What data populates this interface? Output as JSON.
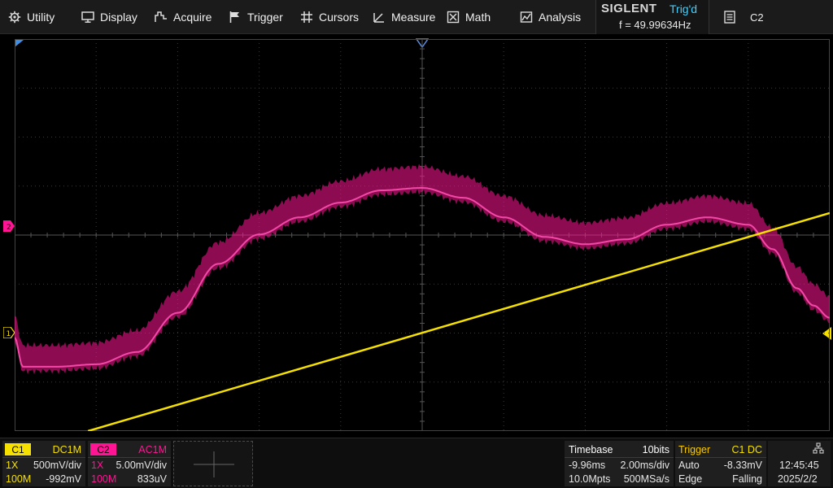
{
  "menu": {
    "utility": "Utility",
    "display": "Display",
    "acquire": "Acquire",
    "trigger": "Trigger",
    "cursors": "Cursors",
    "measure": "Measure",
    "math": "Math",
    "analysis": "Analysis"
  },
  "brand": "SIGLENT",
  "trigger_state": "Trig'd",
  "frequency": "f = 49.99634Hz",
  "channel_button": "C2",
  "colors": {
    "c1": "#f5e000",
    "c2": "#ff1493",
    "trig_label": "#f5c800",
    "panel_bg": "#1f1f1f",
    "grid": "#3a3a3a"
  },
  "c1": {
    "tag": "C1",
    "coupling": "DC1M",
    "probe": "1X",
    "scale": "500mV/div",
    "bandwidth": "100M",
    "offset": "-992mV"
  },
  "c2": {
    "tag": "C2",
    "coupling": "AC1M",
    "probe": "1X",
    "scale": "5.00mV/div",
    "bandwidth": "100M",
    "offset": "833uV"
  },
  "timebase": {
    "label": "Timebase",
    "bits": "10bits",
    "delay": "-9.96ms",
    "scale": "2.00ms/div",
    "memory": "10.0Mpts",
    "sample_rate": "500MSa/s"
  },
  "trigger_panel": {
    "label": "Trigger",
    "source": "C1 DC",
    "mode": "Auto",
    "level": "-8.33mV",
    "type": "Edge",
    "slope": "Falling"
  },
  "clock": {
    "time": "12:45:45",
    "date": "2025/2/2"
  },
  "chart_data": {
    "type": "line",
    "title": "",
    "xlabel": "",
    "ylabel": "",
    "grid": true,
    "x_divisions": 10,
    "y_divisions": 8,
    "xlim_div": [
      -5,
      5
    ],
    "ylim_div": [
      -4,
      4
    ],
    "series": [
      {
        "name": "C1",
        "x_div": [
          -4.1,
          5.0
        ],
        "y_div": [
          -4.0,
          0.45
        ]
      },
      {
        "name": "C2",
        "x_div": [
          -5.0,
          -4.9,
          -4.5,
          -4.0,
          -3.5,
          -3.0,
          -2.5,
          -2.0,
          -1.5,
          -1.0,
          -0.5,
          0.0,
          0.5,
          1.0,
          1.5,
          2.0,
          2.5,
          3.0,
          3.5,
          4.0,
          4.3,
          4.6,
          4.8,
          5.0
        ],
        "y_div": [
          -2.0,
          -2.6,
          -2.6,
          -2.55,
          -2.3,
          -1.5,
          -0.5,
          0.1,
          0.45,
          0.75,
          1.0,
          1.05,
          0.85,
          0.45,
          0.05,
          -0.1,
          0.0,
          0.3,
          0.45,
          0.3,
          -0.2,
          -1.0,
          -1.35,
          -1.6
        ],
        "band_width_div": 0.7
      }
    ]
  }
}
